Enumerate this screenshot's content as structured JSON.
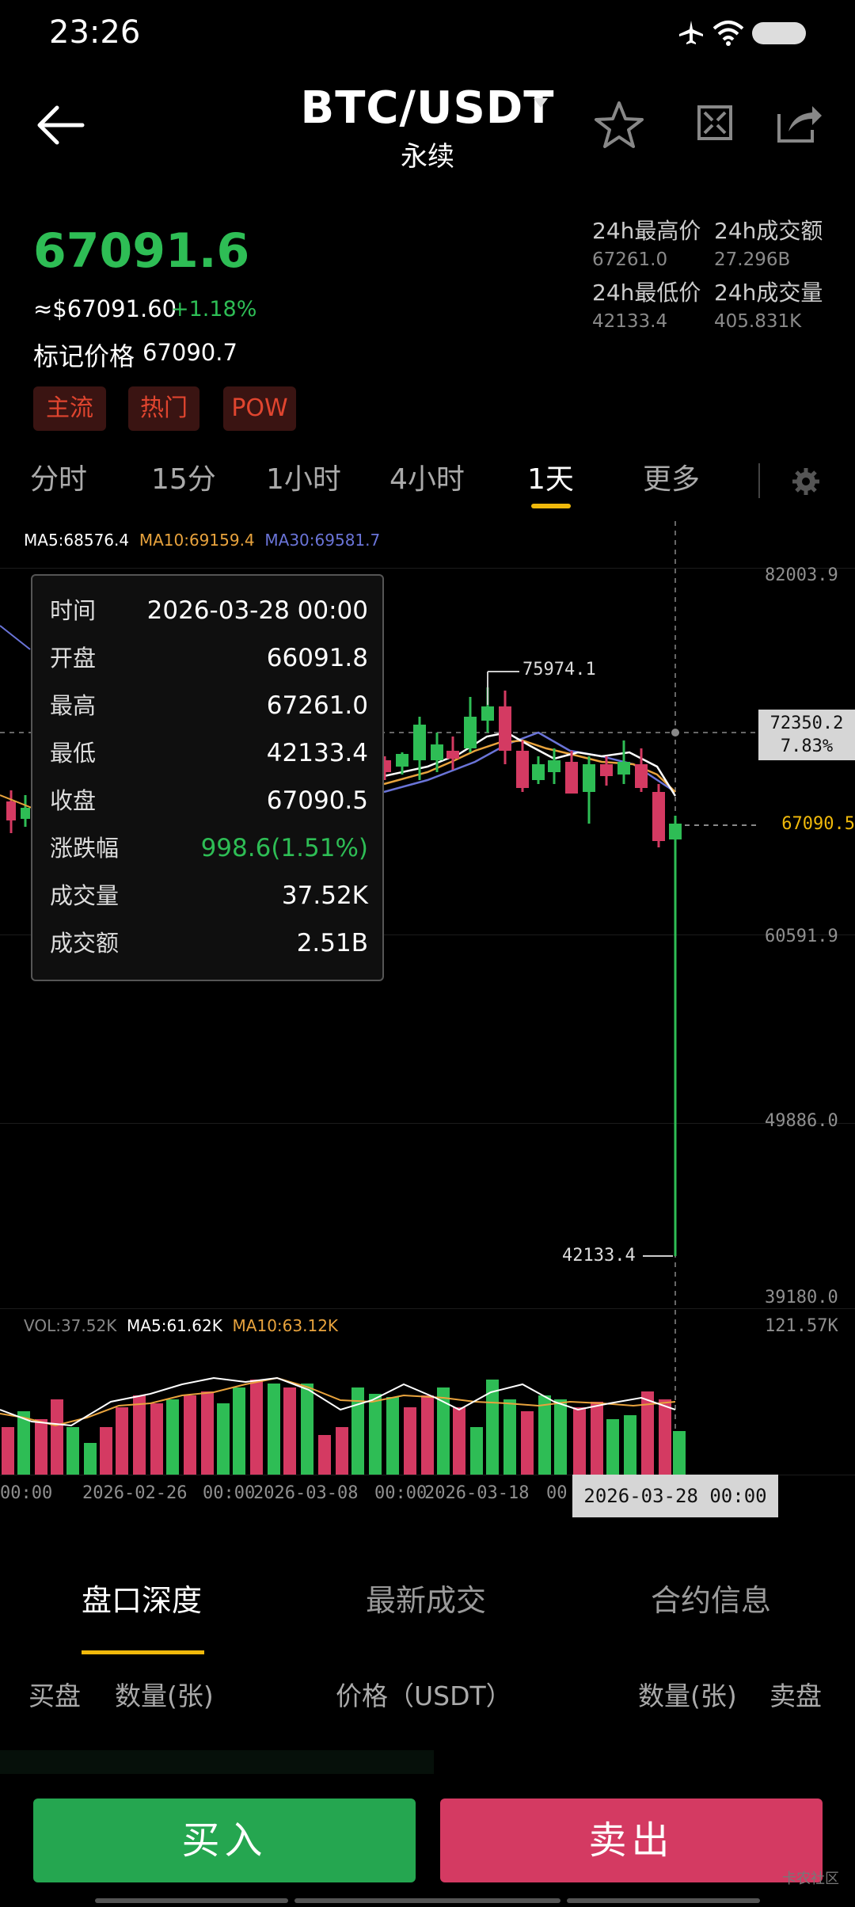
{
  "status_bar": {
    "time": "23:26"
  },
  "header": {
    "pair": "BTC/USDT",
    "subtitle": "永续"
  },
  "price": {
    "last": "67091.6",
    "usd": "≈$67091.60",
    "change": "+1.18%",
    "mark_label": "标记价格",
    "mark_value": "67090.7",
    "tags": [
      "主流",
      "热门",
      "POW"
    ]
  },
  "stats": {
    "high_label": "24h最高价",
    "high_value": "67261.0",
    "turnover_label": "24h成交额",
    "turnover_value": "27.296B",
    "low_label": "24h最低价",
    "low_value": "42133.4",
    "volume_label": "24h成交量",
    "volume_value": "405.831K"
  },
  "time_tabs": [
    "分时",
    "15分",
    "1小时",
    "4小时",
    "1天",
    "更多"
  ],
  "ma_legend": {
    "ma5": "MA5:68576.4",
    "ma10": "MA10:69159.4",
    "ma30": "MA30:69581.7"
  },
  "vol_legend": {
    "vol": "VOL:37.52K",
    "ma5": "MA5:61.62K",
    "ma10": "MA10:63.12K"
  },
  "y_axis": [
    "82003.9",
    "60591.9",
    "49886.0",
    "39180.0"
  ],
  "vol_axis": "121.57K",
  "crosshair": {
    "price": "72350.2",
    "pct": "7.83%"
  },
  "current_price_label": "67090.5",
  "annotations": {
    "high": "75974.1",
    "low": "42133.4"
  },
  "x_axis": [
    "00:00",
    "2026-02-26",
    "00:00",
    "2026-03-08",
    "00:00",
    "2026-03-18",
    "00"
  ],
  "date_tip": "2026-03-28 00:00",
  "tooltip": [
    {
      "k": "时间",
      "v": "2026-03-28 00:00"
    },
    {
      "k": "开盘",
      "v": "66091.8"
    },
    {
      "k": "最高",
      "v": "67261.0"
    },
    {
      "k": "最低",
      "v": "42133.4"
    },
    {
      "k": "收盘",
      "v": "67090.5"
    },
    {
      "k": "涨跌幅",
      "v": "998.6(1.51%)"
    },
    {
      "k": "成交量",
      "v": "37.52K"
    },
    {
      "k": "成交额",
      "v": "2.51B"
    }
  ],
  "bottom_tabs": [
    "盘口深度",
    "最新成交",
    "合约信息"
  ],
  "order_headers": {
    "buy": "买盘",
    "qty_left": "数量(张)",
    "price": "价格（USDT）",
    "qty_right": "数量(张)",
    "sell": "卖盘"
  },
  "actions": {
    "buy": "买入",
    "sell": "卖出"
  },
  "watermark": "卡农社区",
  "colors": {
    "up": "#2ebd55",
    "down": "#d43a62",
    "accent": "#f0b90b",
    "ma5": "#ffffff",
    "ma10": "#e8a33d",
    "ma30": "#6a74d8"
  }
}
